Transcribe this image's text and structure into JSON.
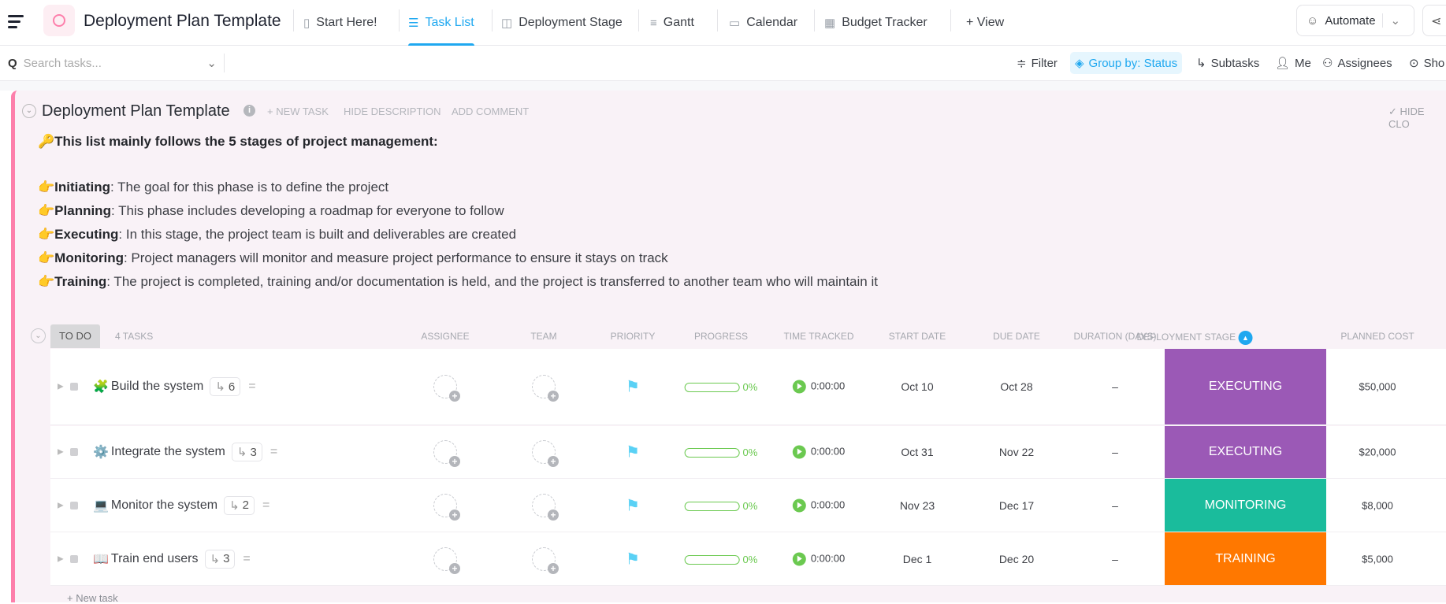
{
  "header": {
    "title": "Deployment Plan Template",
    "tabs": [
      {
        "label": "Start Here!",
        "icon": "doc-icon"
      },
      {
        "label": "Task List",
        "icon": "list-icon",
        "active": true
      },
      {
        "label": "Deployment Stage",
        "icon": "board-icon"
      },
      {
        "label": "Gantt",
        "icon": "gantt-icon"
      },
      {
        "label": "Calendar",
        "icon": "calendar-icon"
      },
      {
        "label": "Budget Tracker",
        "icon": "table-icon"
      }
    ],
    "add_view": "+ View",
    "automate": "Automate"
  },
  "toolbar": {
    "search_placeholder": "Search tasks...",
    "filter": "Filter",
    "group_by": "Group by: Status",
    "subtasks": "Subtasks",
    "me": "Me",
    "assignees": "Assignees",
    "show": "Sho"
  },
  "list": {
    "title": "Deployment Plan Template",
    "new_task": "+ NEW TASK",
    "hide_description": "HIDE DESCRIPTION",
    "add_comment": "ADD COMMENT",
    "hide_closed": "✓ HIDE CLO",
    "description": {
      "intro": "This list mainly follows the 5 stages of project management:",
      "items": [
        {
          "term": "Initiating",
          "text": ": The goal for this phase is to define the project"
        },
        {
          "term": "Planning",
          "text": ": This phase includes developing a roadmap for everyone to follow"
        },
        {
          "term": "Executing",
          "text": ": In this stage, the project team is built and deliverables are created"
        },
        {
          "term": "Monitoring",
          "text": ": Project managers will monitor and measure project performance to ensure it stays on track"
        },
        {
          "term": "Training",
          "text": ": The project is completed, training and/or documentation is held, and the project is transferred to another team who will maintain it"
        }
      ]
    }
  },
  "group": {
    "status": "TO DO",
    "count": "4 TASKS",
    "columns": [
      "ASSIGNEE",
      "TEAM",
      "PRIORITY",
      "PROGRESS",
      "TIME TRACKED",
      "START DATE",
      "DUE DATE",
      "DURATION (DAYS)",
      "DEPLOYMENT STAGE",
      "PLANNED COST"
    ],
    "new_task": "+ New task"
  },
  "tasks": [
    {
      "emoji": "🧩",
      "name": "Build the system",
      "subtasks": "6",
      "progress": "0%",
      "time": "0:00:00",
      "start": "Oct 10",
      "due": "Oct 28",
      "duration": "–",
      "stage": "EXECUTING",
      "stage_color": "#9b59b6",
      "cost": "$50,000"
    },
    {
      "emoji": "⚙️",
      "name": "Integrate the system",
      "subtasks": "3",
      "progress": "0%",
      "time": "0:00:00",
      "start": "Oct 31",
      "due": "Nov 22",
      "duration": "–",
      "stage": "EXECUTING",
      "stage_color": "#9b59b6",
      "cost": "$20,000"
    },
    {
      "emoji": "💻",
      "name": "Monitor the system",
      "subtasks": "2",
      "progress": "0%",
      "time": "0:00:00",
      "start": "Nov 23",
      "due": "Dec 17",
      "duration": "–",
      "stage": "MONITORING",
      "stage_color": "#1abc9c",
      "cost": "$8,000"
    },
    {
      "emoji": "📖",
      "name": "Train end users",
      "subtasks": "3",
      "progress": "0%",
      "time": "0:00:00",
      "start": "Dec 1",
      "due": "Dec 20",
      "duration": "–",
      "stage": "TRAINING",
      "stage_color": "#ff7800",
      "cost": "$5,000"
    }
  ],
  "colors": {
    "accent": "#1fa8f0",
    "list_border": "#fd7fab",
    "progress": "#6bc950",
    "priority_flag": "#5ad1f5"
  }
}
